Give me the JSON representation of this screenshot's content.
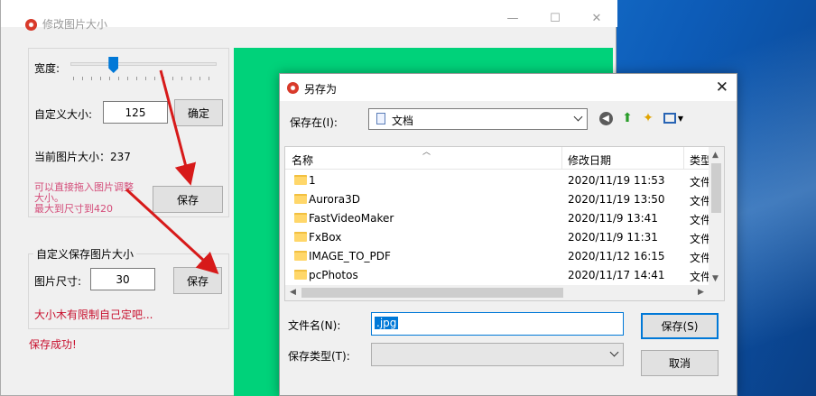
{
  "main_window": {
    "title": "修改图片大小",
    "width_label": "宽度:",
    "width_slider_fraction": 0.28,
    "custom_size_label": "自定义大小:",
    "custom_size_value": "125",
    "confirm_button": "确定",
    "current_size_label": "当前图片大小：237",
    "drag_hint": "可以直接拖入图片调整大小。\n最大到尺寸到420",
    "save_button_1": "保存",
    "custom_save_group_title": "自定义保存图片大小",
    "image_size_label": "图片尺寸:",
    "image_size_value": "30",
    "save_button_2": "保存",
    "limit_hint": "大小木有限制自己定吧...",
    "save_status": "保存成功!"
  },
  "dialog": {
    "title": "另存为",
    "save_in_label": "保存在(I):",
    "save_in_value": "文档",
    "columns": {
      "name": "名称",
      "date": "修改日期",
      "type": "类型"
    },
    "rows": [
      {
        "name": "1",
        "date": "2020/11/19 11:53",
        "type": "文件"
      },
      {
        "name": "Aurora3D",
        "date": "2020/11/19 13:50",
        "type": "文件"
      },
      {
        "name": "FastVideoMaker",
        "date": "2020/11/9 13:41",
        "type": "文件"
      },
      {
        "name": "FxBox",
        "date": "2020/11/9 11:31",
        "type": "文件"
      },
      {
        "name": "IMAGE_TO_PDF",
        "date": "2020/11/12 16:15",
        "type": "文件"
      },
      {
        "name": "pcPhotos",
        "date": "2020/11/17 14:41",
        "type": "文件"
      }
    ],
    "filename_label": "文件名(N):",
    "filename_value": ".jpg",
    "filetype_label": "保存类型(T):",
    "filetype_value": "",
    "save_button": "保存(S)",
    "cancel_button": "取消"
  },
  "colors": {
    "preview_green": "#00d27a",
    "annotation_red": "#d71a1a",
    "accent_blue": "#0078d7"
  }
}
